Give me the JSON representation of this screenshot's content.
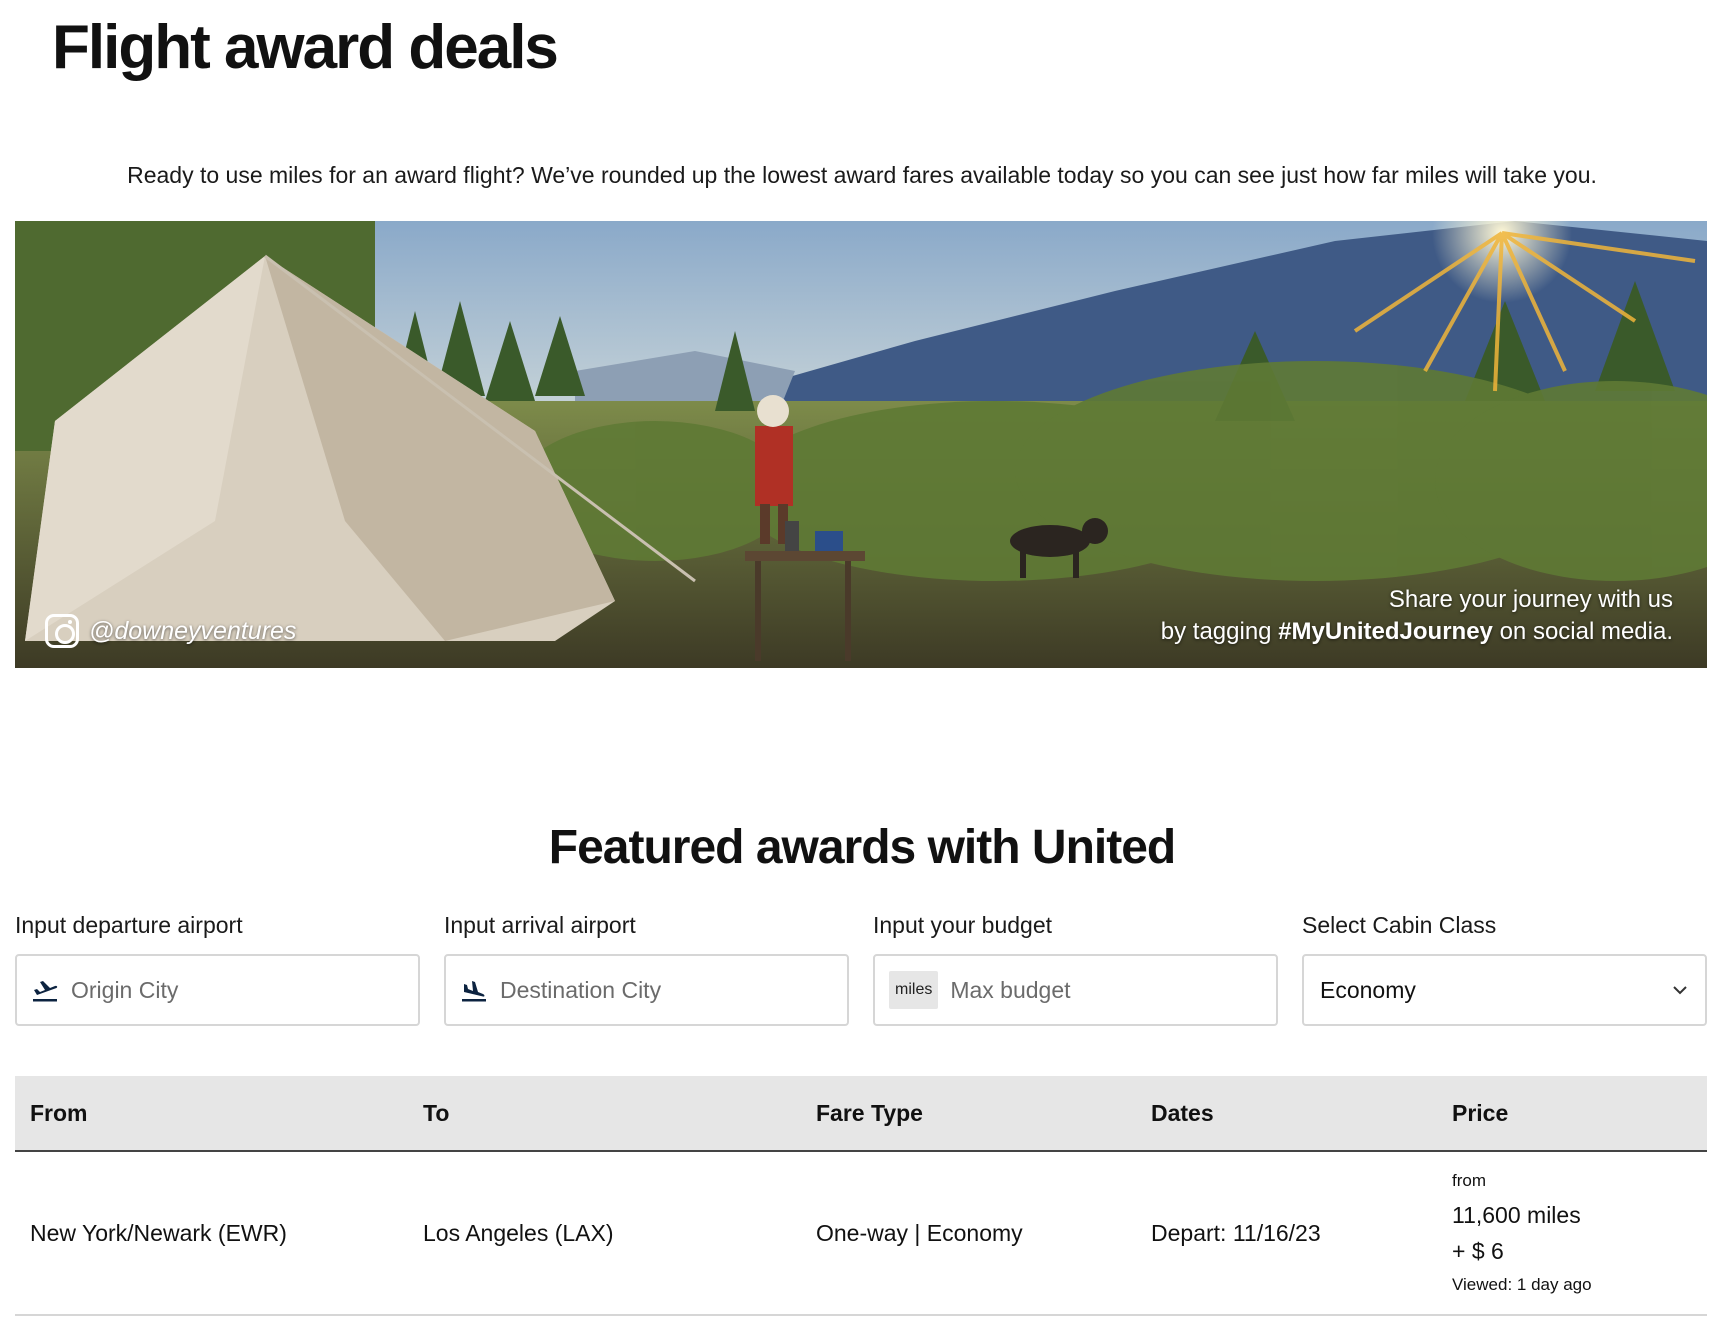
{
  "page": {
    "title": "Flight award deals",
    "intro": "Ready to use miles for an award flight? We’ve rounded up the lowest award fares available today so you can see just how far miles will take you."
  },
  "hero": {
    "handle": "@downeyventures",
    "caption_line1": "Share your journey with us",
    "caption_prefix": "by tagging ",
    "caption_hashtag": "#MyUnitedJourney",
    "caption_suffix": " on social media."
  },
  "section": {
    "title": "Featured awards with United"
  },
  "filters": {
    "departure": {
      "label": "Input departure airport",
      "placeholder": "Origin City",
      "icon": "takeoff-icon"
    },
    "arrival": {
      "label": "Input arrival airport",
      "placeholder": "Destination City",
      "icon": "landing-icon"
    },
    "budget": {
      "label": "Input your budget",
      "tag": "miles",
      "placeholder": "Max budget"
    },
    "cabin": {
      "label": "Select Cabin Class",
      "value": "Economy",
      "icon": "chevron-down-icon"
    }
  },
  "table": {
    "headers": {
      "from": "From",
      "to": "To",
      "fare_type": "Fare Type",
      "dates": "Dates",
      "price": "Price"
    },
    "rows": [
      {
        "from": "New York/Newark (EWR)",
        "to": "Los Angeles (LAX)",
        "fare_type": "One-way | Economy",
        "dates": "Depart: 11/16/23",
        "price_from": "from",
        "price_miles": "11,600 miles",
        "price_fee": "+ $ 6",
        "viewed": "Viewed: 1 day ago"
      }
    ]
  },
  "colors": {
    "table_header_bg": "#e6e6e6",
    "border": "#d6d6d6",
    "text": "#111111"
  }
}
